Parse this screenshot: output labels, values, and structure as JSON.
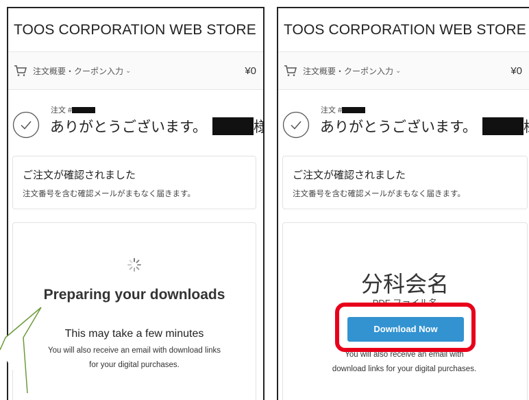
{
  "left_panel": {
    "store_name": "TOOS CORPORATION WEB STORE",
    "summary_label": "注文概要・クーポン入力",
    "summary_price": "¥0",
    "order_prefix": "注文 #",
    "thanks_text": "ありがとうございます。",
    "thanks_suffix": "様!",
    "confirm_title": "ご注文が確認されました",
    "confirm_sub": "注文番号を含む確認メールがまもなく届きます。",
    "preparing_title": "Preparing your downloads",
    "preparing_sub": "This may take a few minutes",
    "email_note": "You will also receive an email with download links for your digital purchases."
  },
  "right_panel": {
    "store_name": "TOOS CORPORATION WEB STORE",
    "summary_label": "注文概要・クーポン入力",
    "summary_price": "¥0",
    "order_prefix": "注文 #",
    "thanks_text": "ありがとうございます。",
    "thanks_suffix": "様!",
    "confirm_title": "ご注文が確認されました",
    "confirm_sub": "注文番号を含む確認メールがまもなく届きます。",
    "product_title": "分科会名",
    "product_file": "PDF ファイル名",
    "download_button": "Download Now",
    "email_note": "You will also receive an email with download links for your digital purchases."
  },
  "icons": [
    "cart-icon",
    "chevron-down-icon",
    "check-circle-icon",
    "spinner-icon"
  ],
  "colors": {
    "download_button": "#3393d1",
    "highlight": "#e8001b",
    "callout_stroke": "#6a9a3a"
  }
}
